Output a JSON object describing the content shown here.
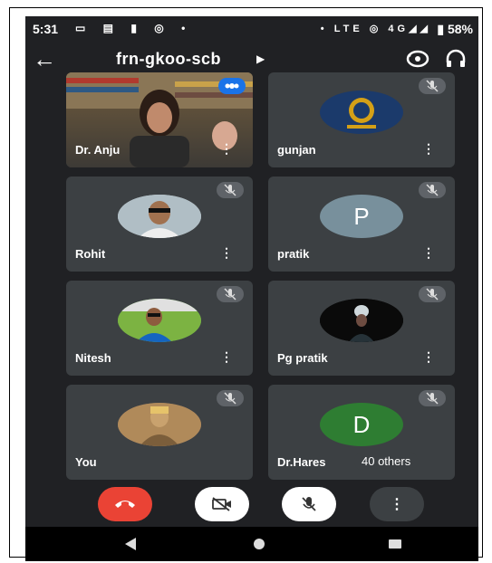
{
  "status": {
    "time": "5:31",
    "network": "LTE",
    "signal": "4G",
    "battery": "58%"
  },
  "meeting": {
    "title": "frn-gkoo-scb"
  },
  "participants": [
    {
      "name": "Dr. Anju",
      "kind": "video",
      "muted": false
    },
    {
      "name": "gunjan",
      "kind": "logo",
      "muted": true
    },
    {
      "name": "Rohit",
      "kind": "photo",
      "muted": true
    },
    {
      "name": "pratik",
      "kind": "letter",
      "letter": "P",
      "color": "#78909c",
      "muted": true
    },
    {
      "name": "Nitesh",
      "kind": "photo",
      "muted": true
    },
    {
      "name": "Pg pratik",
      "kind": "photo",
      "muted": true
    },
    {
      "name": "You",
      "kind": "photo",
      "muted": true
    },
    {
      "name": "Dr.Hares",
      "kind": "letter",
      "letter": "D",
      "color": "#2e7d32",
      "muted": true
    }
  ],
  "others_label": "40 others",
  "colors": {
    "end_call": "#ea4335",
    "tile_bg": "#3c4043",
    "speaking": "#1a73e8"
  },
  "icons": {
    "back": "arrow-left-icon",
    "camera_switch": "camera-switch-icon",
    "audio": "headphones-icon",
    "muted": "mic-off-icon",
    "more": "more-vert-icon"
  }
}
